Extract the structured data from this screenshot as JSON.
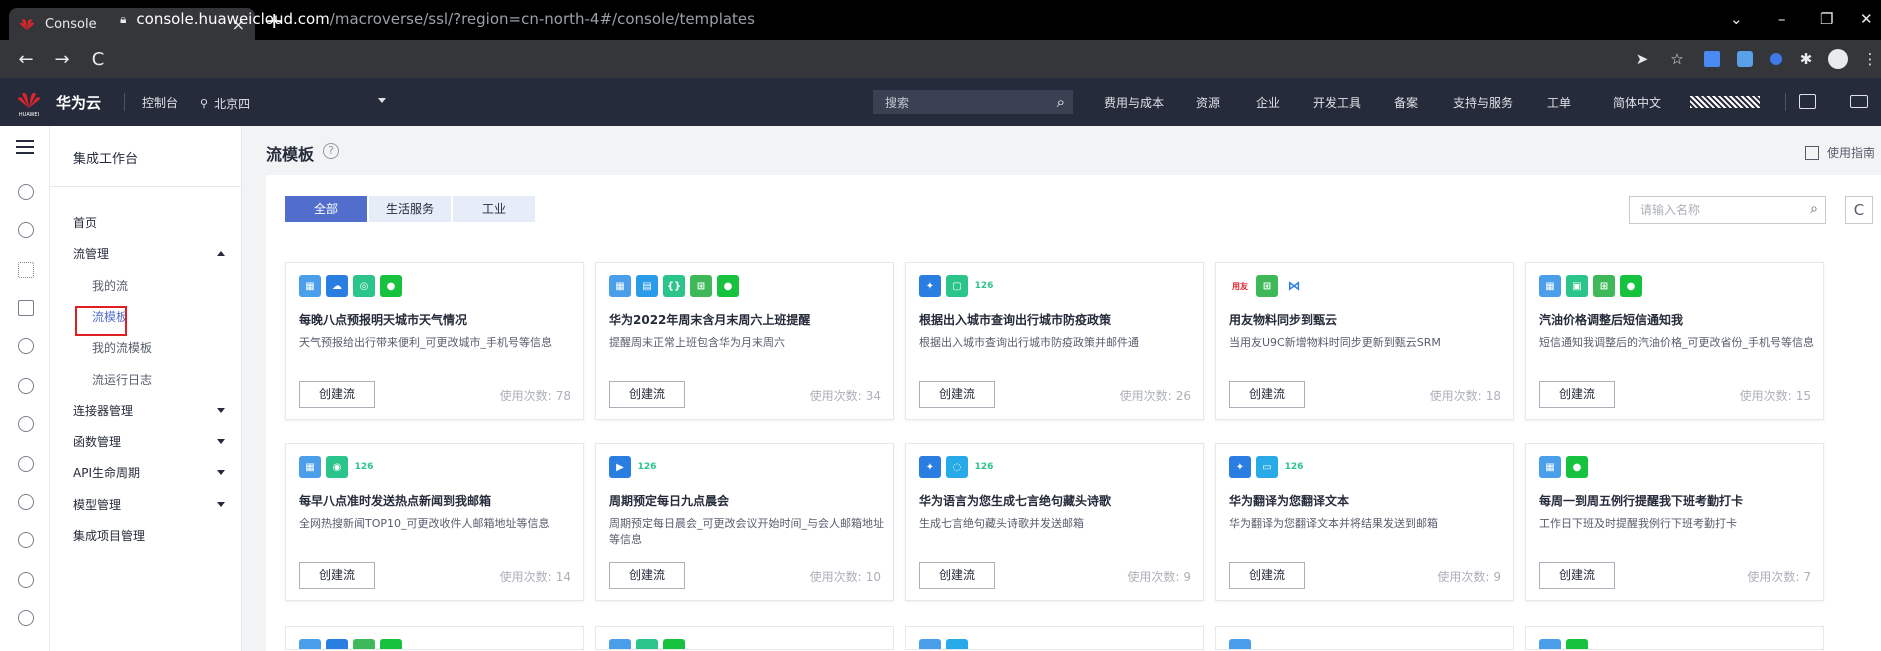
{
  "browser": {
    "tab_title": "Console",
    "tab_close": "×",
    "new_tab": "+",
    "url_host": "console.huaweicloud.com",
    "url_path": "/macroverse/ssl/?region=cn-north-4#/console/templates"
  },
  "topnav": {
    "brand": "华为云",
    "console": "控制台",
    "region": "北京四",
    "search_label": "搜索",
    "links": [
      "费用与成本",
      "资源",
      "企业",
      "开发工具",
      "备案",
      "支持与服务",
      "工单",
      "简体中文"
    ]
  },
  "sidebar": {
    "title": "集成工作台",
    "items": [
      {
        "label": "首页"
      },
      {
        "label": "流管理"
      },
      {
        "label": "我的流"
      },
      {
        "label": "流模板"
      },
      {
        "label": "我的流模板"
      },
      {
        "label": "流运行日志"
      },
      {
        "label": "连接器管理"
      },
      {
        "label": "函数管理"
      },
      {
        "label": "API生命周期"
      },
      {
        "label": "模型管理"
      },
      {
        "label": "集成项目管理"
      }
    ]
  },
  "main": {
    "title": "流模板",
    "help": "?",
    "guide": "使用指南",
    "tabs": [
      "全部",
      "生活服务",
      "工业"
    ],
    "search_placeholder": "请输入名称",
    "refresh": "C",
    "create_label": "创建流",
    "use_label": "使用次数:",
    "cards": [
      {
        "title": "每晚八点预报明天城市天气情况",
        "desc": "天气预报给出行带来便利_可更改城市_手机号等信息",
        "uses": "78"
      },
      {
        "title": "华为2022年周末含月末周六上班提醒",
        "desc": "提醒周末正常上班包含华为月末周六",
        "uses": "34"
      },
      {
        "title": "根据出入城市查询出行城市防疫政策",
        "desc": "根据出入城市查询出行城市防疫政策并邮件通",
        "uses": "26"
      },
      {
        "title": "用友物料同步到甄云",
        "desc": "当用友U9C新增物料时同步更新到甄云SRM",
        "uses": "18"
      },
      {
        "title": "汽油价格调整后短信通知我",
        "desc": "短信通知我调整后的汽油价格_可更改省份_手机号等信息",
        "uses": "15"
      },
      {
        "title": "每早八点准时发送热点新闻到我邮箱",
        "desc": "全网热搜新闻TOP10_可更改收件人邮箱地址等信息",
        "uses": "14"
      },
      {
        "title": "周期预定每日九点晨会",
        "desc": "周期预定每日晨会_可更改会议开始时间_与会人邮箱地址等信息",
        "uses": "10"
      },
      {
        "title": "华为语言为您生成七言绝句藏头诗歌",
        "desc": "生成七言绝句藏头诗歌并发送邮箱",
        "uses": "9"
      },
      {
        "title": "华为翻译为您翻译文本",
        "desc": "华为翻译为您翻译文本并将结果发送到邮箱",
        "uses": "9"
      },
      {
        "title": "每周一到周五例行提醒我下班考勤打卡",
        "desc": "工作日下班及时提醒我例行下班考勤打卡",
        "uses": "7"
      }
    ]
  },
  "colors": {
    "topnav_bg": "#252b3a",
    "tab_active": "#526ecc",
    "tab_inactive": "#e6ecf8",
    "highlight_box": "#e02020"
  }
}
